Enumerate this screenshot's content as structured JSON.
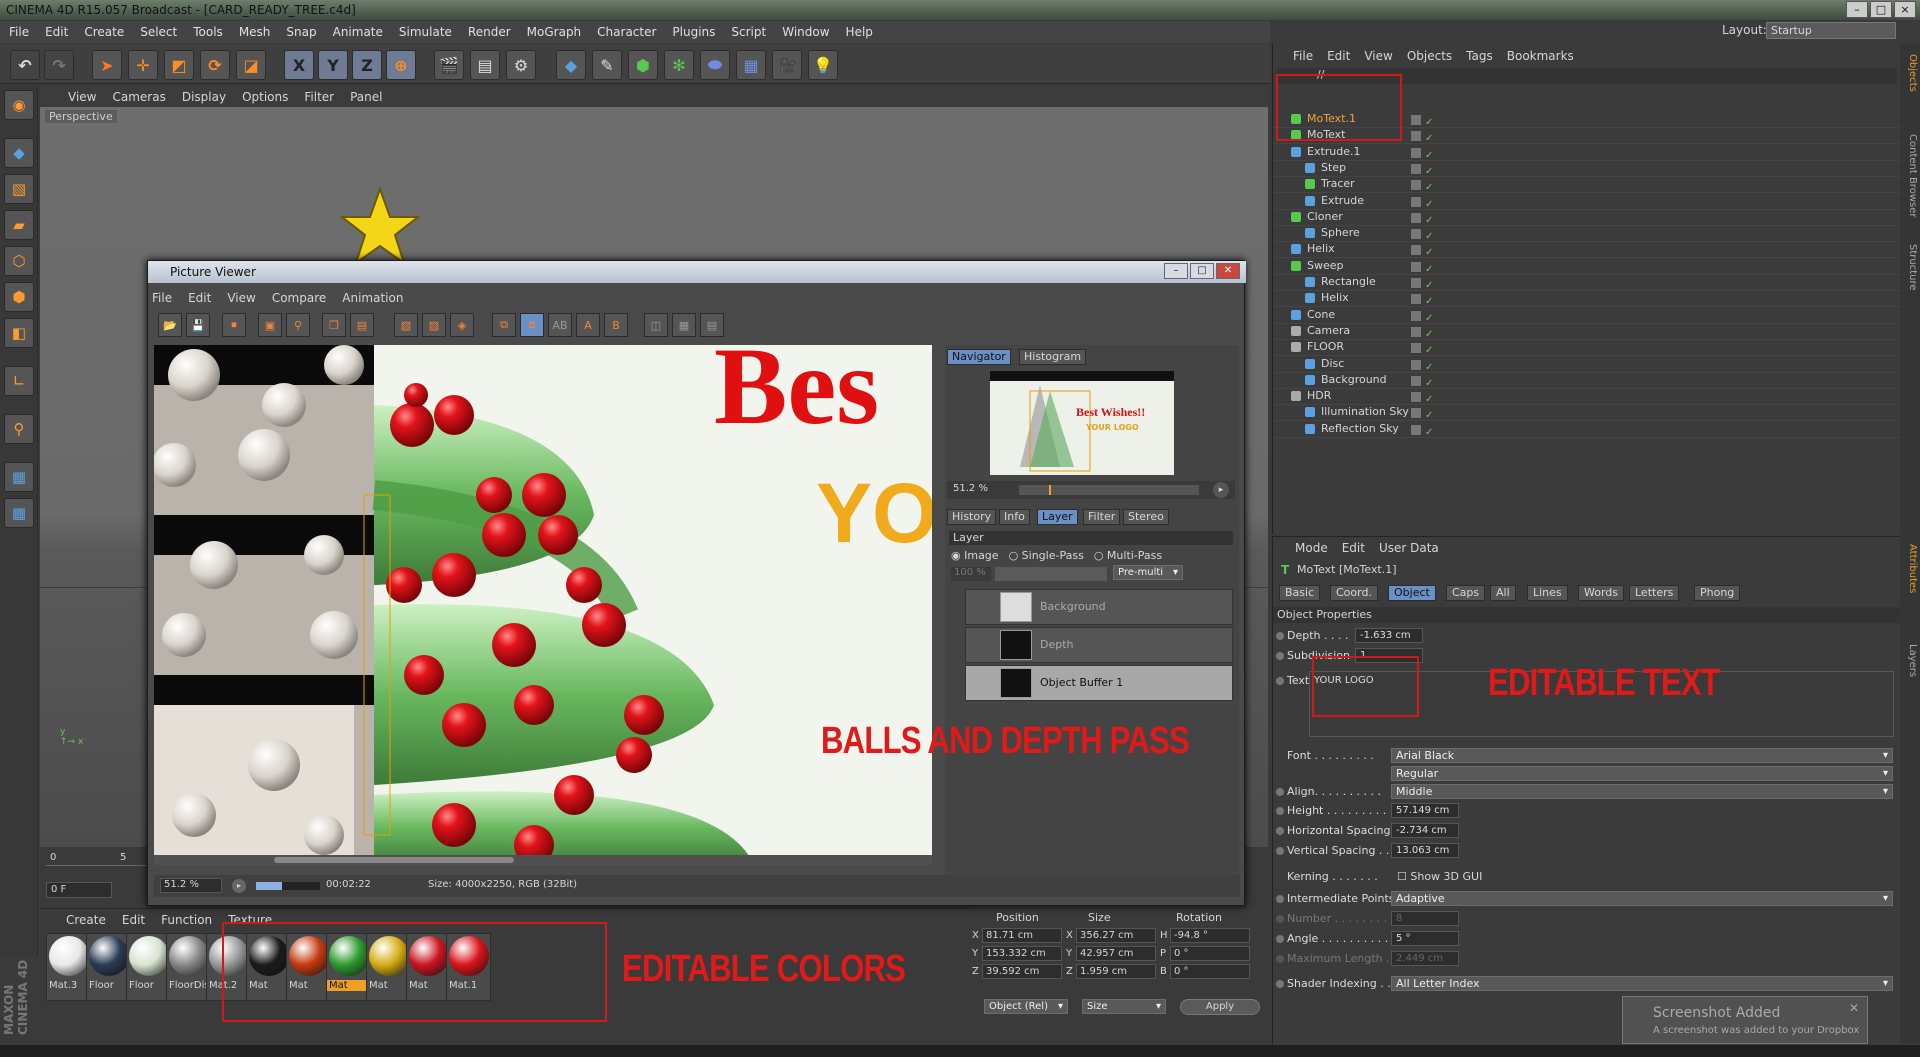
{
  "app": {
    "title": "CINEMA 4D R15.057 Broadcast - [CARD_READY_TREE.c4d]"
  },
  "menubar": [
    "File",
    "Edit",
    "Create",
    "Select",
    "Tools",
    "Mesh",
    "Snap",
    "Animate",
    "Simulate",
    "Render",
    "MoGraph",
    "Character",
    "Plugins",
    "Script",
    "Window",
    "Help"
  ],
  "layout": {
    "label": "Layout:",
    "value": "Startup"
  },
  "viewport": {
    "menu": [
      "View",
      "Cameras",
      "Display",
      "Options",
      "Filter",
      "Panel"
    ],
    "label": "Perspective"
  },
  "timeline": {
    "frame": "0 F",
    "ticks": [
      "0",
      "5"
    ]
  },
  "materials": {
    "menu": [
      "Create",
      "Edit",
      "Function",
      "Texture"
    ],
    "items": [
      {
        "name": "Mat.3",
        "color": "#e8e8e8"
      },
      {
        "name": "Floor",
        "color": "#2b3b55"
      },
      {
        "name": "Floor",
        "color": "#d8e3d0"
      },
      {
        "name": "FloorDis",
        "color": "#888888"
      },
      {
        "name": "Mat.2",
        "color": "#9a9a9a"
      },
      {
        "name": "Mat",
        "color": "#1b1b1b"
      },
      {
        "name": "Mat",
        "color": "#c53a10"
      },
      {
        "name": "Mat",
        "color": "#2e9a2e"
      },
      {
        "name": "Mat",
        "color": "#d6ac12"
      },
      {
        "name": "Mat",
        "color": "#c91420"
      },
      {
        "name": "Mat.1",
        "color": "#d9141a"
      }
    ]
  },
  "coords": {
    "headers": [
      "Position",
      "Size",
      "Rotation"
    ],
    "rows": [
      {
        "axis": "X",
        "pos": "81.71 cm",
        "saxis": "X",
        "size": "356.27 cm",
        "raxis": "H",
        "rot": "-94.8 °"
      },
      {
        "axis": "Y",
        "pos": "153.332 cm",
        "saxis": "Y",
        "size": "42.957 cm",
        "raxis": "P",
        "rot": "0 °"
      },
      {
        "axis": "Z",
        "pos": "39.592 cm",
        "saxis": "Z",
        "size": "1.959 cm",
        "raxis": "B",
        "rot": "0 °"
      }
    ],
    "mode": "Object (Rel)",
    "size_mode": "Size",
    "apply": "Apply"
  },
  "picture_viewer": {
    "title": "Picture Viewer",
    "menu": [
      "File",
      "Edit",
      "View",
      "Compare",
      "Animation"
    ],
    "nav_tabs": [
      "Navigator",
      "Histogram"
    ],
    "thumb_text1": "Best Wishes!!",
    "thumb_text2": "YOUR LOGO",
    "zoom": "51.2 %",
    "tabs": [
      "History",
      "Info",
      "Layer",
      "Filter",
      "Stereo"
    ],
    "layer_title": "Layer",
    "modes": [
      "Image",
      "Single-Pass",
      "Multi-Pass"
    ],
    "opacity": "100 %",
    "blend": "Pre-multi",
    "layers": [
      "Background",
      "Depth",
      "Object Buffer 1"
    ],
    "status_zoom": "51.2 %",
    "time": "00:02:22",
    "size": "Size: 4000x2250, RGB (32Bit)",
    "render_text1": "Bes",
    "render_text2": "YO"
  },
  "objects": {
    "menu": [
      "File",
      "Edit",
      "View",
      "Objects",
      "Tags",
      "Bookmarks"
    ],
    "path": "//",
    "items": [
      {
        "name": "MoText.1",
        "indent": 0,
        "color": "#57c94b",
        "hl": true
      },
      {
        "name": "MoText",
        "indent": 0,
        "color": "#57c94b"
      },
      {
        "name": "Extrude.1",
        "indent": 0,
        "color": "#5aa1e0"
      },
      {
        "name": "Step",
        "indent": 1,
        "color": "#5aa1e0"
      },
      {
        "name": "Tracer",
        "indent": 1,
        "color": "#57c94b"
      },
      {
        "name": "Extrude",
        "indent": 1,
        "color": "#5aa1e0"
      },
      {
        "name": "Cloner",
        "indent": 0,
        "color": "#57c94b"
      },
      {
        "name": "Sphere",
        "indent": 1,
        "color": "#5aa1e0"
      },
      {
        "name": "Helix",
        "indent": 0,
        "color": "#5aa1e0"
      },
      {
        "name": "Sweep",
        "indent": 0,
        "color": "#57c94b"
      },
      {
        "name": "Rectangle",
        "indent": 1,
        "color": "#5aa1e0"
      },
      {
        "name": "Helix",
        "indent": 1,
        "color": "#5aa1e0"
      },
      {
        "name": "Cone",
        "indent": 0,
        "color": "#5aa1e0"
      },
      {
        "name": "Camera",
        "indent": 0,
        "color": "#aaaaaa"
      },
      {
        "name": "FLOOR",
        "indent": 0,
        "color": "#aaaaaa"
      },
      {
        "name": "Disc",
        "indent": 1,
        "color": "#5aa1e0"
      },
      {
        "name": "Background",
        "indent": 1,
        "color": "#5aa1e0"
      },
      {
        "name": "HDR",
        "indent": 0,
        "color": "#aaaaaa"
      },
      {
        "name": "Illumination Sky",
        "indent": 1,
        "color": "#5aa1e0"
      },
      {
        "name": "Reflection Sky",
        "indent": 1,
        "color": "#5aa1e0"
      }
    ]
  },
  "attributes": {
    "menu": [
      "Mode",
      "Edit",
      "User Data"
    ],
    "object_name": "MoText [MoText.1]",
    "tabs": [
      "Basic",
      "Coord.",
      "Object",
      "Caps",
      "All",
      "Lines",
      "Words",
      "Letters",
      "Phong"
    ],
    "section": "Object Properties",
    "depth_label": "Depth . . . .",
    "depth": "-1.633 cm",
    "subdivision_label": "Subdivision",
    "subdivision": "1",
    "text_label": "Text",
    "text": "YOUR LOGO",
    "font_label": "Font . . . . . . . . .",
    "font": "Arial Black",
    "font_style": "Regular",
    "align_label": "Align. . . . . . . . . .",
    "align": "Middle",
    "height_label": "Height . . . . . . . . . .",
    "height": "57.149 cm",
    "hspacing_label": "Horizontal Spacing",
    "hspacing": "-2.734 cm",
    "vspacing_label": "Vertical Spacing . .",
    "vspacing": "13.063 cm",
    "kerning_label": "Kerning . . . . . . .",
    "show3d": "Show 3D GUI",
    "intpoints_label": "Intermediate Points",
    "intpoints": "Adaptive",
    "number_label": "Number . . . . . . . .",
    "number": "8",
    "angle_label": "Angle . . . . . . . . . .",
    "angle": "5 °",
    "maxlen_label": "Maximum Length . .",
    "maxlen": "2.449 cm",
    "shader_label": "Shader Indexing . .",
    "shader": "All Letter Index"
  },
  "sidebar": [
    "Objects",
    "Content Browser",
    "Structure",
    "Attributes",
    "Layers"
  ],
  "callouts": {
    "editable_text": "EDITABLE TEXT",
    "balls_depth": "BALLS AND DEPTH PASS",
    "editable_colors": "EDITABLE COLORS"
  },
  "toast": {
    "title": "Screenshot Added",
    "body": "A screenshot was added to your Dropbox"
  },
  "logo": "MAXON CINEMA 4D"
}
